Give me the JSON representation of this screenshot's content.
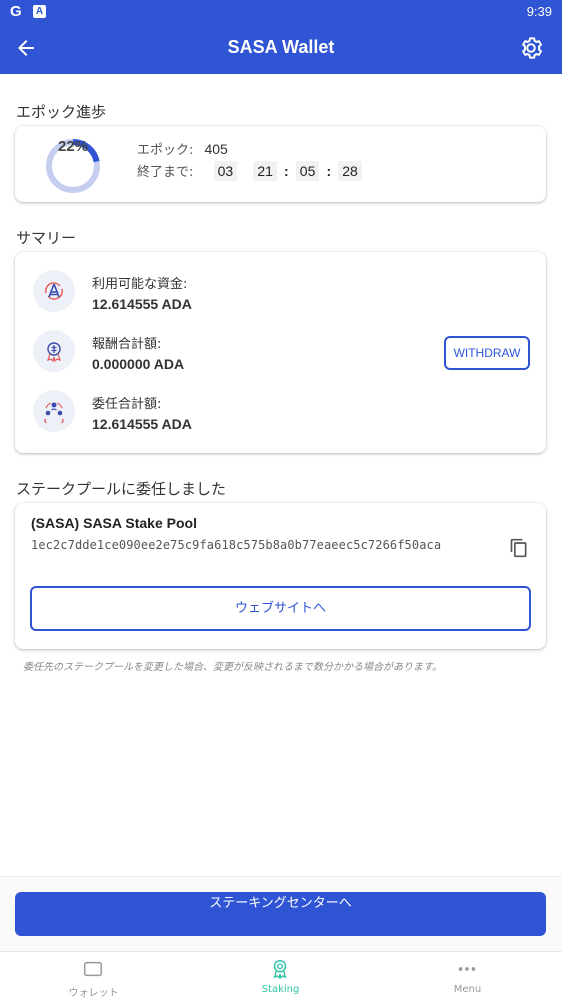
{
  "status_bar": {
    "time": "9:39",
    "icon_g": "G",
    "icon_a": "A"
  },
  "app_bar": {
    "title": "SASA Wallet",
    "back_icon": "arrow-left-icon",
    "settings_icon": "gear-icon"
  },
  "epoch": {
    "section_title": "エポック進歩",
    "progress_text": "22%",
    "progress_value": 0.22,
    "epoch_label": "エポック:",
    "epoch_value": "405",
    "remaining_label": "終了まで:",
    "days": "03",
    "hours": "21",
    "minutes": "05",
    "seconds": "28"
  },
  "summary": {
    "section_title": "サマリー",
    "items": [
      {
        "label": "利用可能な資金:",
        "value": "12.614555 ADA",
        "icon": "ada-coin-icon"
      },
      {
        "label": "報酬合計額:",
        "value": "0.000000 ADA",
        "icon": "reward-badge-icon"
      },
      {
        "label": "委任合計額:",
        "value": "12.614555 ADA",
        "icon": "delegation-users-icon"
      }
    ],
    "withdraw_label": "WITHDRAW"
  },
  "pool": {
    "section_title": "ステークプールに委任しました",
    "name": "(SASA) SASA Stake Pool",
    "hash": "1ec2c7dde1ce090ee2e75c9fa618c575b8a0b77eaeec5c7266f50aca",
    "website_label": "ウェブサイトへ",
    "note": "委任先のステークプールを変更した場合、変更が反映されるまで数分かかる場合があります。"
  },
  "staking_center_label": "ステーキングセンターへ",
  "nav": {
    "items": [
      {
        "label": "ウォレット",
        "icon": "wallet-icon",
        "active": false
      },
      {
        "label": "Staking",
        "icon": "staking-badge-icon",
        "active": true
      },
      {
        "label": "Menu",
        "icon": "more-dots-icon",
        "active": false
      }
    ]
  },
  "colors": {
    "primary": "#2f55d4",
    "accent": "#2ec4a6",
    "ring_bg": "#c5cef0"
  }
}
